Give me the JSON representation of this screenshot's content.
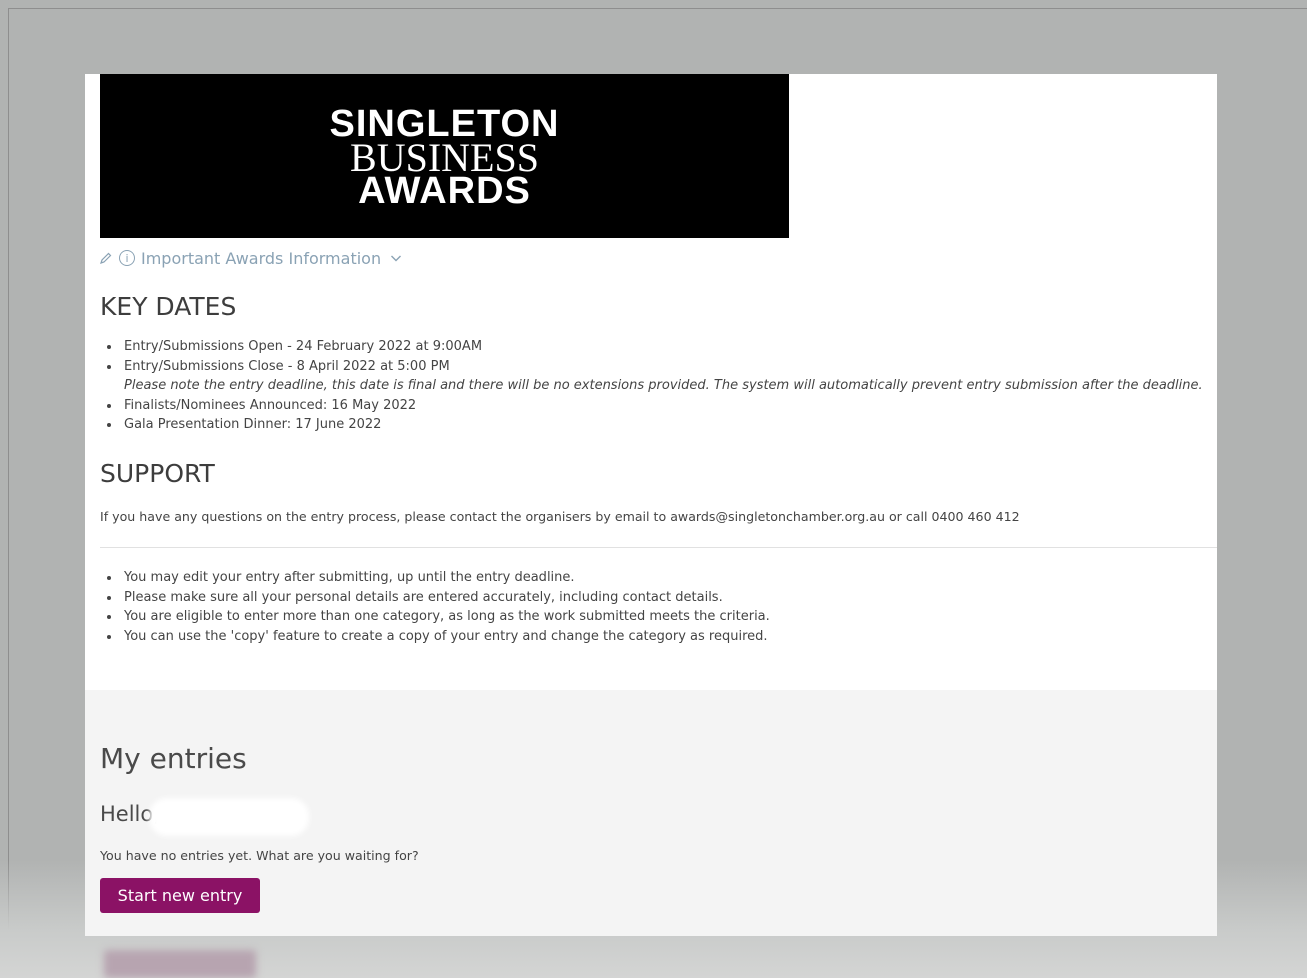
{
  "banner": {
    "line1": "SINGLETON",
    "line2": "BUSINESS",
    "line3": "AWARDS"
  },
  "info": {
    "label": "Important Awards Information",
    "icons": [
      "edit-icon",
      "info-icon",
      "chevron-down-icon"
    ]
  },
  "key_dates": {
    "heading": "KEY DATES",
    "items": [
      "Entry/Submissions Open - 24 February 2022 at 9:00AM",
      "Entry/Submissions Close - 8 April 2022 at 5:00 PM",
      "Please note the entry deadline, this date is final and there will be no extensions provided. The system will automatically prevent entry submission after the deadline.",
      "Finalists/Nominees Announced: 16 May 2022",
      "Gala Presentation Dinner: 17 June 2022"
    ]
  },
  "support": {
    "heading": "SUPPORT",
    "text": "If you have any questions on the entry process, please contact the organisers by email to awards@singletonchamber.org.au or call 0400 460 412"
  },
  "tips": [
    "You may edit your entry after submitting, up until the entry deadline.",
    "Please make sure all your personal details are entered accurately, including contact details.",
    "You are eligible to enter more than one category, as long as the work submitted meets the criteria.",
    "You can use the 'copy' feature to create a copy of your entry and change the category as required."
  ],
  "entries": {
    "title": "My entries",
    "hello": "Hello,",
    "empty_text": "You have no entries yet. What are you waiting for?",
    "start_button": "Start new entry"
  },
  "colors": {
    "accent": "#8b1265",
    "link": "#8aa2b4",
    "backdrop": "#b1b3b2"
  }
}
